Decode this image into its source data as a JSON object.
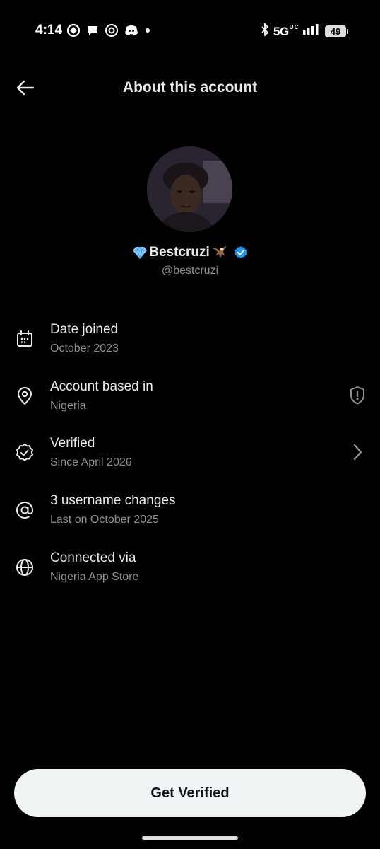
{
  "status_bar": {
    "time": "4:14",
    "network": "5G",
    "network_sup": "U C",
    "battery": "49",
    "left_icons": [
      "signal-app-icon",
      "chat-icon",
      "threads-icon",
      "discord-icon",
      "dot-icon"
    ],
    "right_icons": [
      "bluetooth-icon",
      "signal-bars-icon",
      "battery-icon"
    ]
  },
  "header": {
    "title": "About this account",
    "back_icon": "arrow-left-icon"
  },
  "profile": {
    "display_name": "Bestcruzi",
    "handle": "@bestcruzi",
    "verified_color": "#1d9bf0"
  },
  "info_items": [
    {
      "title": "Date joined",
      "subtitle": "October 2023",
      "icon": "calendar-icon"
    },
    {
      "title": "Account based in",
      "subtitle": "Nigeria",
      "icon": "location-pin-icon",
      "trailing_icon": "shield-alert-icon"
    },
    {
      "title": "Verified",
      "subtitle": "Since April 2026",
      "icon": "verified-badge-outline-icon",
      "trailing_icon": "chevron-right-icon"
    },
    {
      "title": "3 username changes",
      "subtitle": "Last on October 2025",
      "icon": "at-sign-icon"
    },
    {
      "title": "Connected via",
      "subtitle": "Nigeria App Store",
      "icon": "globe-icon"
    }
  ],
  "cta": {
    "label": "Get Verified"
  },
  "colors": {
    "background": "#000000",
    "primary_text": "#e7e9ea",
    "secondary_text": "#8b9096",
    "button_bg": "#eff3f4",
    "button_text": "#0f1419",
    "verified_blue": "#1d9bf0"
  }
}
